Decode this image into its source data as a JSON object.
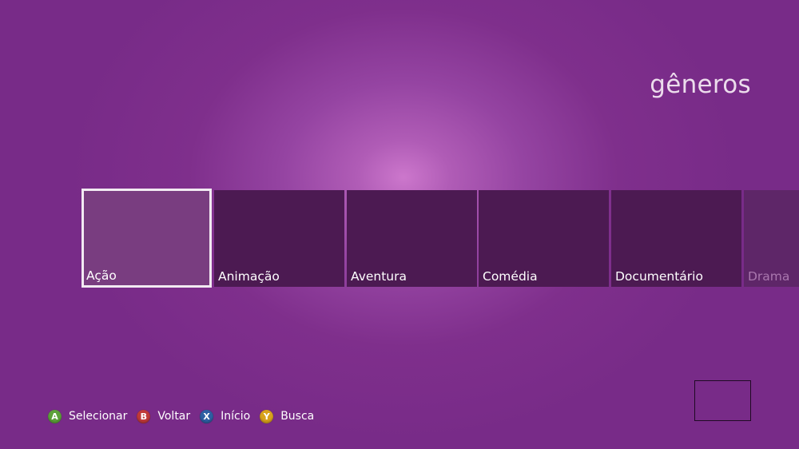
{
  "page": {
    "title": "gêneros"
  },
  "tiles": [
    {
      "label": "Ação",
      "selected": true
    },
    {
      "label": "Animação",
      "selected": false
    },
    {
      "label": "Aventura",
      "selected": false
    },
    {
      "label": "Comédia",
      "selected": false
    },
    {
      "label": "Documentário",
      "selected": false
    },
    {
      "label": "Drama",
      "selected": false
    }
  ],
  "legend": [
    {
      "button": "A",
      "label": "Selecionar",
      "color": "#5da13a"
    },
    {
      "button": "B",
      "label": "Voltar",
      "color": "#c03a3a"
    },
    {
      "button": "X",
      "label": "Início",
      "color": "#2e5fa3"
    },
    {
      "button": "Y",
      "label": "Busca",
      "color": "#d8a21c"
    }
  ],
  "colors": {
    "background": "#7f2f8c",
    "glow": "#cc77cc",
    "tile": "#4c1a52",
    "tile_selected": "#793d80"
  }
}
